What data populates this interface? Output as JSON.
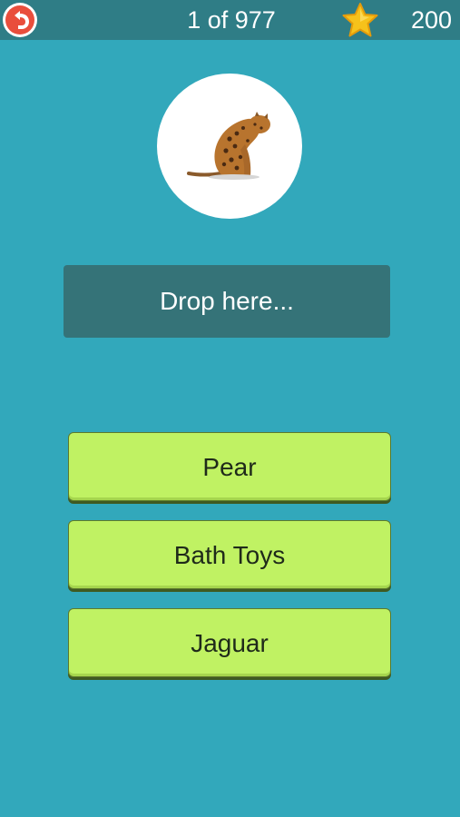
{
  "header": {
    "back_icon": "undo-arrow-icon",
    "progress": "1 of 977",
    "star_icon": "star-icon",
    "score": "200"
  },
  "question": {
    "image": "jaguar-sitting-illustration"
  },
  "dropzone": {
    "label": "Drop here..."
  },
  "answers": [
    {
      "label": "Pear"
    },
    {
      "label": "Bath Toys"
    },
    {
      "label": "Jaguar"
    }
  ],
  "colors": {
    "background": "#32a8bb",
    "header_bar": "#2f7d86",
    "dropzone": "#357378",
    "answer_button": "#c0f263",
    "back_button": "#e94e3c",
    "star": "#f6c21b"
  }
}
